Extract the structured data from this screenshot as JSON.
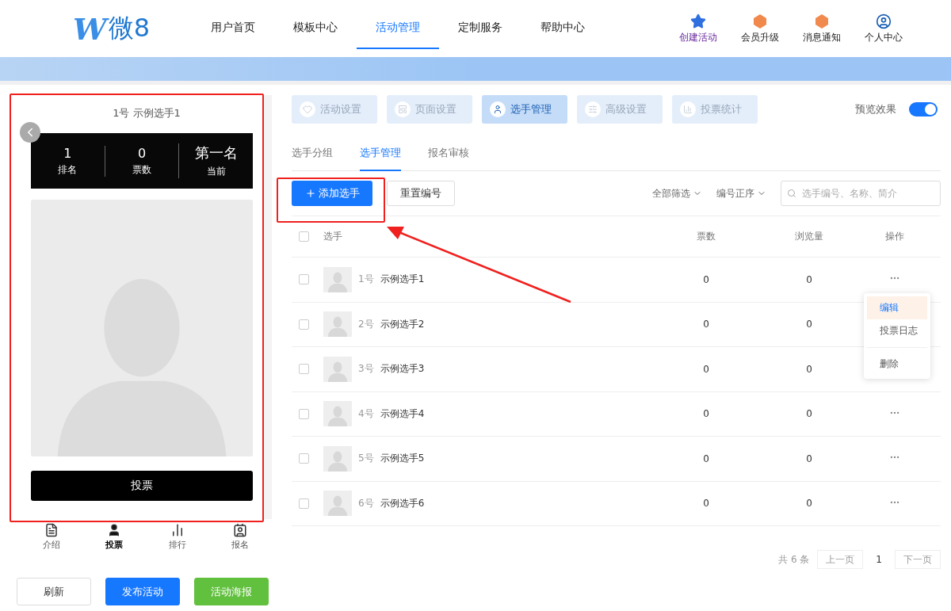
{
  "header": {
    "logo_letter": "W",
    "logo_text": "微8",
    "nav": [
      {
        "label": "用户首页",
        "selected": false
      },
      {
        "label": "模板中心",
        "selected": false
      },
      {
        "label": "活动管理",
        "selected": true
      },
      {
        "label": "定制服务",
        "selected": false
      },
      {
        "label": "帮助中心",
        "selected": false
      }
    ],
    "actions": [
      {
        "kind": "create",
        "label": "创建活动"
      },
      {
        "kind": "upgrade",
        "label": "会员升级"
      },
      {
        "kind": "notice",
        "label": "消息通知"
      },
      {
        "kind": "user",
        "label": "个人中心"
      }
    ]
  },
  "preview": {
    "title": "1号 示例选手1",
    "stats": [
      {
        "value": "1",
        "label": "排名"
      },
      {
        "value": "0",
        "label": "票数"
      },
      {
        "value": "第一名",
        "label": "当前"
      }
    ],
    "vote_button": "投票",
    "bottom_nav": [
      {
        "kind": "intro",
        "label": "介绍",
        "selected": false
      },
      {
        "kind": "vote",
        "label": "投票",
        "selected": true
      },
      {
        "kind": "rank",
        "label": "排行",
        "selected": false
      },
      {
        "kind": "signup",
        "label": "报名",
        "selected": false
      }
    ],
    "buttons": [
      {
        "kind": "plain",
        "label": "刷新"
      },
      {
        "kind": "primary",
        "label": "发布活动"
      },
      {
        "kind": "success",
        "label": "活动海报"
      }
    ]
  },
  "settings_tabs": [
    {
      "kind": "heart",
      "label": "活动设置",
      "selected": false
    },
    {
      "kind": "page",
      "label": "页面设置",
      "selected": false
    },
    {
      "kind": "person",
      "label": "选手管理",
      "selected": true
    },
    {
      "kind": "sliders",
      "label": "高级设置",
      "selected": false
    },
    {
      "kind": "chart",
      "label": "投票统计",
      "selected": false
    }
  ],
  "preview_toggle": {
    "label": "预览效果",
    "on": true
  },
  "sub_tabs": [
    {
      "label": "选手分组",
      "selected": false
    },
    {
      "label": "选手管理",
      "selected": true
    },
    {
      "label": "报名审核",
      "selected": false
    }
  ],
  "toolbar": {
    "add_button": "添加选手",
    "reset_button": "重置编号",
    "filters": [
      "全部筛选",
      "编号正序"
    ],
    "search": {
      "placeholder": "选手编号、名称、简介"
    }
  },
  "table": {
    "columns": [
      "选手",
      "票数",
      "浏览量",
      "操作"
    ],
    "header_checked": false,
    "rows": [
      {
        "number": "1号",
        "name": "示例选手1",
        "votes": "0",
        "views": "0",
        "checked": false,
        "show_actions": true
      },
      {
        "number": "2号",
        "name": "示例选手2",
        "votes": "0",
        "views": "0",
        "checked": false,
        "show_actions": false
      },
      {
        "number": "3号",
        "name": "示例选手3",
        "votes": "0",
        "views": "0",
        "checked": false,
        "show_actions": false
      },
      {
        "number": "4号",
        "name": "示例选手4",
        "votes": "0",
        "views": "0",
        "checked": false,
        "show_actions": true
      },
      {
        "number": "5号",
        "name": "示例选手5",
        "votes": "0",
        "views": "0",
        "checked": false,
        "show_actions": true
      },
      {
        "number": "6号",
        "name": "示例选手6",
        "votes": "0",
        "views": "0",
        "checked": false,
        "show_actions": true
      }
    ]
  },
  "action_menu": {
    "items": [
      {
        "label": "编辑",
        "selected": true
      },
      {
        "label": "投票日志",
        "selected": false
      },
      {
        "label": "删除",
        "selected": false
      }
    ]
  },
  "pagination": {
    "total": "共 6 条",
    "prev": "上一页",
    "page": "1",
    "next": "下一页"
  }
}
